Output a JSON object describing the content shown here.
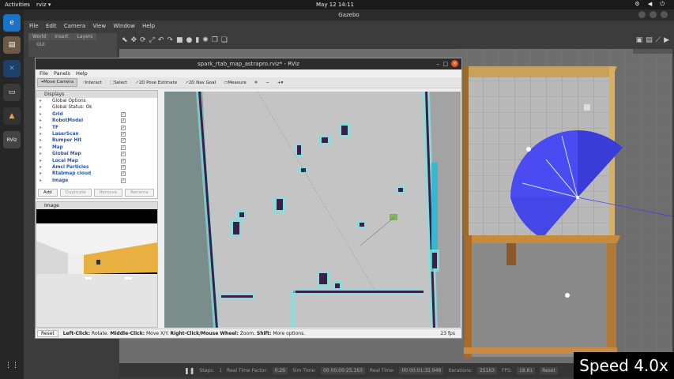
{
  "topbar": {
    "activities": "Activities",
    "app": "rviz ▾",
    "clock": "May 12  14:11",
    "tray": "⚙ ◀ ⏻"
  },
  "dock": {
    "items": [
      {
        "label": "e"
      },
      {
        "label": "▤"
      },
      {
        "label": "✕"
      },
      {
        "label": "▭"
      },
      {
        "label": "▲"
      },
      {
        "label": "RViz"
      },
      {
        "label": "⋮⋮"
      }
    ]
  },
  "gazebo": {
    "title": "Gazebo",
    "menu": [
      "File",
      "Edit",
      "Camera",
      "View",
      "Window",
      "Help"
    ],
    "tabs": [
      "World",
      "Insert",
      "Layers"
    ],
    "gui": "GUI",
    "bottom": {
      "steps_label": "Steps:",
      "steps": "1",
      "rtf_label": "Real Time Factor:",
      "rtf": "0.26",
      "sim_label": "Sim Time:",
      "sim": "00 00:00:25.163",
      "real_label": "Real Time:",
      "real": "00 00:01:31.948",
      "iter_label": "Iterations:",
      "iter": "25163",
      "fps_label": "FPS:",
      "fps": "18.81",
      "reset": "Reset"
    }
  },
  "rviz": {
    "title": "spark_rtab_map_astrapro.rviz* - RViz",
    "menu": [
      "File",
      "Panels",
      "Help"
    ],
    "tools": [
      "Move Camera",
      "Interact",
      "Select",
      "2D Pose Estimate",
      "2D Nav Goal",
      "Measure"
    ],
    "displays_title": "Displays",
    "displays": [
      {
        "name": "Global Options",
        "checked": ""
      },
      {
        "name": "Global Status: Ok",
        "checked": ""
      },
      {
        "name": "Grid",
        "checked": "✓"
      },
      {
        "name": "RobotModel",
        "checked": "✓"
      },
      {
        "name": "TF",
        "checked": "✓"
      },
      {
        "name": "LaserScan",
        "checked": "✓"
      },
      {
        "name": "Bumper Hit",
        "checked": "✓"
      },
      {
        "name": "Map",
        "checked": "✓"
      },
      {
        "name": "Global Map",
        "checked": "✓"
      },
      {
        "name": "Local Map",
        "checked": "✓"
      },
      {
        "name": "Amcl Particles",
        "checked": "✓"
      },
      {
        "name": "Rtabmap cloud",
        "checked": "✓"
      },
      {
        "name": "Image",
        "checked": "✓"
      }
    ],
    "buttons": [
      "Add",
      "Duplicate",
      "Remove",
      "Rename"
    ],
    "image_title": "Image",
    "status": {
      "reset": "Reset",
      "hint_b1": "Left-Click:",
      "hint_t1": " Rotate. ",
      "hint_b2": "Middle-Click:",
      "hint_t2": " Move X/Y. ",
      "hint_b3": "Right-Click/Mouse Wheel:",
      "hint_t3": " Zoom. ",
      "hint_b4": "Shift:",
      "hint_t4": " More options.",
      "fps": "23 fps"
    }
  },
  "overlay": {
    "speed": "Speed 4.0x"
  }
}
